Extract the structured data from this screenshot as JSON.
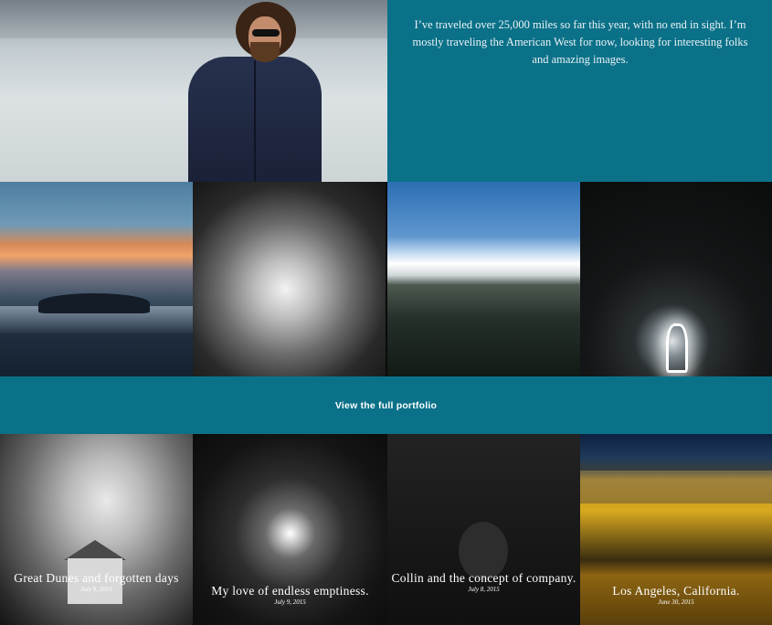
{
  "intro": {
    "text": "I’ve traveled over 25,000 miles so far this year, with no end in sight. I’m mostly traveling the American West for now, looking for interesting folks and amazing images."
  },
  "gallery": {
    "images": [
      "sunset-island-photo",
      "ocean-splash-photo",
      "sea-grass-photo",
      "light-figure-forest-photo"
    ]
  },
  "portfolio": {
    "link_label": "View the full portfolio"
  },
  "posts": [
    {
      "title": "Great Dunes and forgotten days",
      "date": "July 9, 2015"
    },
    {
      "title": "My love of endless emptiness.",
      "date": "July 9, 2015"
    },
    {
      "title": "Collin and the concept of company.",
      "date": "July 8, 2015"
    },
    {
      "title": "Los Angeles, California.",
      "date": "June 30, 2015"
    }
  ],
  "colors": {
    "teal": "#0b7189"
  }
}
